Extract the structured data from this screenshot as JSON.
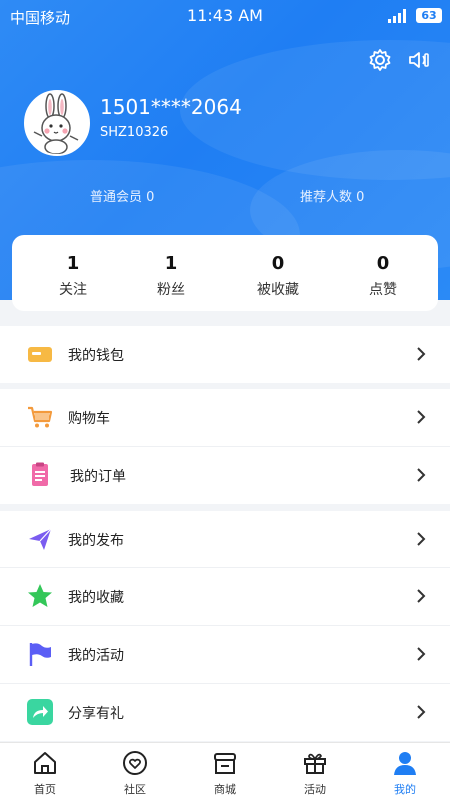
{
  "status_bar": {
    "carrier": "中国移动",
    "time": "11:43 AM",
    "battery": "63"
  },
  "header_icons": [
    "gear-icon",
    "speaker-icon"
  ],
  "profile": {
    "phone": "1501****2064",
    "user_id": "SHZ10326",
    "member_level": "普通会员 0",
    "referral_count": "推荐人数 0"
  },
  "stats": [
    {
      "value": "1",
      "label": "关注"
    },
    {
      "value": "1",
      "label": "粉丝"
    },
    {
      "value": "0",
      "label": "被收藏"
    },
    {
      "value": "0",
      "label": "点赞"
    }
  ],
  "menu": [
    {
      "label": "我的钱包",
      "icon": "wallet-icon",
      "color": "#f7b944"
    },
    {
      "label": "购物车",
      "icon": "cart-icon",
      "color": "#f39a3c"
    },
    {
      "label": "我的订单",
      "icon": "order-icon",
      "color": "#f06aa8"
    },
    {
      "label": "我的发布",
      "icon": "paper-plane-icon",
      "color": "#7b5cf0"
    },
    {
      "label": "我的收藏",
      "icon": "star-icon",
      "color": "#34c759"
    },
    {
      "label": "我的活动",
      "icon": "flag-icon",
      "color": "#5b5ef5"
    },
    {
      "label": "分享有礼",
      "icon": "share-icon",
      "color": "#3ad6a0"
    }
  ],
  "tabs": [
    {
      "label": "首页",
      "icon": "home-icon"
    },
    {
      "label": "社区",
      "icon": "community-icon"
    },
    {
      "label": "商城",
      "icon": "store-icon"
    },
    {
      "label": "活动",
      "icon": "gift-icon"
    },
    {
      "label": "我的",
      "icon": "profile-icon",
      "active": true
    }
  ],
  "colors": {
    "brand_blue": "#1f7ef3",
    "page_background": "#f2f4f7"
  }
}
